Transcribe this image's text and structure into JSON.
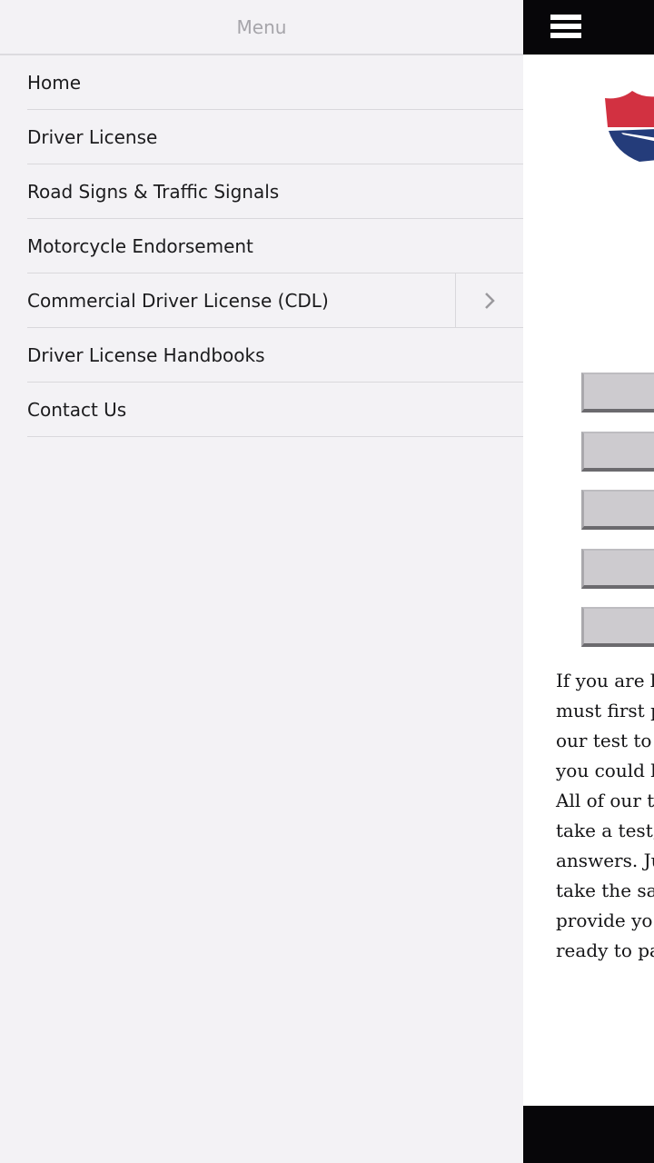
{
  "drawer": {
    "title": "Menu",
    "items": [
      {
        "label": "Home",
        "has_submenu": false
      },
      {
        "label": "Driver License",
        "has_submenu": false
      },
      {
        "label": "Road Signs & Traffic Signals",
        "has_submenu": false
      },
      {
        "label": "Motorcycle Endorsement",
        "has_submenu": false
      },
      {
        "label": "Commercial Driver License (CDL)",
        "has_submenu": true
      },
      {
        "label": "Driver License Handbooks",
        "has_submenu": false
      },
      {
        "label": "Contact Us",
        "has_submenu": false
      }
    ]
  },
  "content": {
    "menu_icon": "hamburger-icon",
    "logo_icon": "shield-logo-icon",
    "buttons_count": 5,
    "paragraph_lines": [
      "If you are l",
      "must first p",
      "our test to",
      "you could l",
      "All of our t",
      "take a test,",
      "answers. Ju",
      "take the sa",
      "provide yo",
      "ready to pa"
    ]
  },
  "colors": {
    "drawer_bg": "#f3f2f5",
    "topbar_bg": "#070609",
    "logo_red": "#d23141",
    "logo_blue": "#243c7a"
  }
}
